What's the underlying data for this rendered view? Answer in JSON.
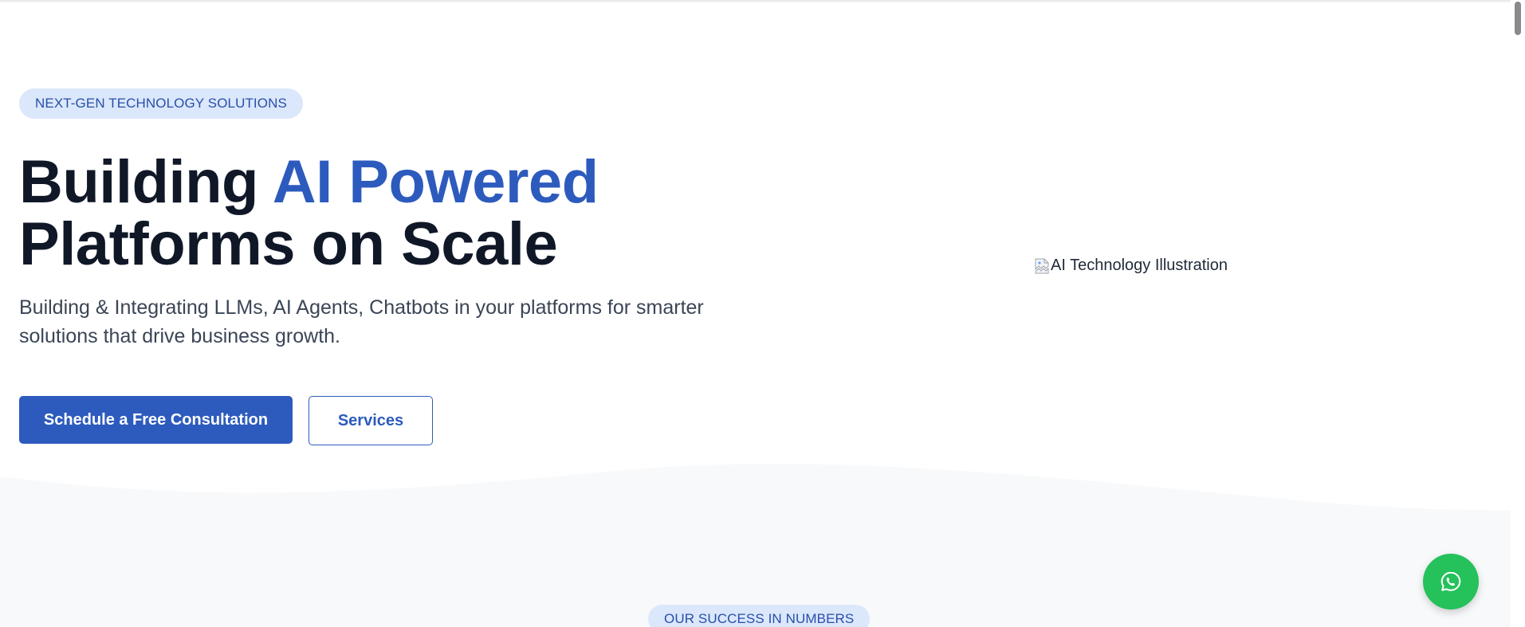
{
  "hero": {
    "badge": "NEXT-GEN TECHNOLOGY SOLUTIONS",
    "headline_part1": "Building ",
    "headline_accent": "AI Powered",
    "headline_part2": "Platforms on Scale",
    "subtitle": "Building & Integrating LLMs, AI Agents, Chatbots in your platforms for smarter solutions that drive business growth.",
    "primary_button": "Schedule a Free Consultation",
    "secondary_button": "Services",
    "image_alt": "AI Technology Illustration"
  },
  "stats": {
    "badge": "OUR SUCCESS IN NUMBERS"
  },
  "floating": {
    "whatsapp_icon": "whatsapp-icon"
  },
  "colors": {
    "brand_blue": "#2d5bbd",
    "badge_bg": "#dbe7fb",
    "heading_dark": "#101828",
    "whatsapp_green": "#25c15b",
    "section_bg": "#f7f9fb"
  }
}
